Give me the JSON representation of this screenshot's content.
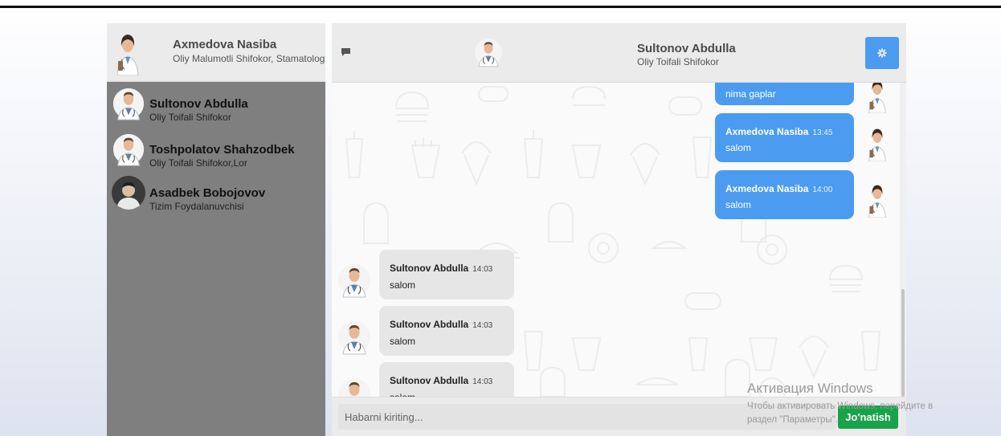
{
  "current_user": {
    "name": "Axmedova Nasiba",
    "role": "Oliy Malumotli Shifokor, Stamatolog"
  },
  "contacts": [
    {
      "name": "Sultonov Abdulla",
      "role": "Oliy Toifali Shifokor",
      "avatar": "doctor-avatar"
    },
    {
      "name": "Toshpolatov Shahzodbek",
      "role": "Oliy Toifali Shifokor,Lor",
      "avatar": "doctor-avatar"
    },
    {
      "name": "Asadbek Bobojovov",
      "role": "Tizim Foydalanuvchisi",
      "avatar": "user-photo-avatar"
    }
  ],
  "chat": {
    "peer_name": "Sultonov Abdulla",
    "peer_role": "Oliy Toifali Shifokor",
    "messages": [
      {
        "direction": "out",
        "sender": "",
        "time": "",
        "text": "nima gaplar"
      },
      {
        "direction": "out",
        "sender": "Axmedova Nasiba",
        "time": "13:45",
        "text": "salom"
      },
      {
        "direction": "out",
        "sender": "Axmedova Nasiba",
        "time": "14:00",
        "text": "salom"
      },
      {
        "direction": "in",
        "sender": "Sultonov Abdulla",
        "time": "14:03",
        "text": "salom"
      },
      {
        "direction": "in",
        "sender": "Sultonov Abdulla",
        "time": "14:03",
        "text": "salom"
      },
      {
        "direction": "in",
        "sender": "Sultonov Abdulla",
        "time": "14:03",
        "text": "salom"
      }
    ]
  },
  "composer": {
    "placeholder": "Habarni kiriting...",
    "value": "",
    "send_label": "Jo'natish"
  },
  "watermark": {
    "title": "Активация Windows",
    "line1": "Чтобы активировать Windows, перейдите в",
    "line2": "раздел \"Параметры\"."
  },
  "colors": {
    "accent": "#4b9bf0",
    "send": "#18a34a",
    "sidebar": "#7f7f7f",
    "header": "#ebebeb",
    "incoming_bubble": "#e6e6e6"
  },
  "icons": {
    "header_left": "message-icon",
    "settings": "gear-icon"
  }
}
